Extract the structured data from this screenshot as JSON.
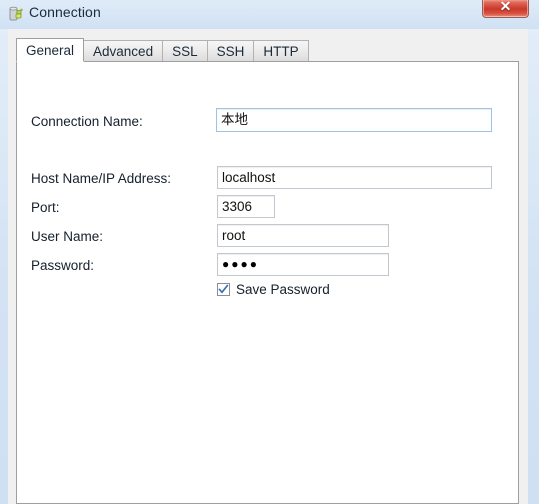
{
  "window": {
    "title": "Connection",
    "title_icon": "connection-plug-icon",
    "close_label": "✕",
    "close_icon": "close-icon"
  },
  "tabs": [
    {
      "label": "General",
      "active": true
    },
    {
      "label": "Advanced",
      "active": false
    },
    {
      "label": "SSL",
      "active": false
    },
    {
      "label": "SSH",
      "active": false
    },
    {
      "label": "HTTP",
      "active": false
    }
  ],
  "form": {
    "connection_name": {
      "label": "Connection Name:",
      "value": "本地",
      "placeholder": ""
    },
    "host": {
      "label": "Host Name/IP Address:",
      "value": "localhost",
      "placeholder": ""
    },
    "port": {
      "label": "Port:",
      "value": "3306",
      "placeholder": ""
    },
    "user_name": {
      "label": "User Name:",
      "value": "root",
      "placeholder": ""
    },
    "password": {
      "label": "Password:",
      "value": "●●●●",
      "placeholder": ""
    },
    "save_password": {
      "label": "Save Password",
      "checked": true
    }
  },
  "colors": {
    "titlebar_top": "#dfebf8",
    "titlebar_bottom": "#cfe1f3",
    "close_red": "#c8392a",
    "dialog_bg": "#f0f0f0",
    "panel_bg": "#ffffff",
    "field_border": "#c2c8cf",
    "focus_border": "#9dc4e6",
    "check_blue": "#2f6ab5",
    "text": "#15202b"
  }
}
